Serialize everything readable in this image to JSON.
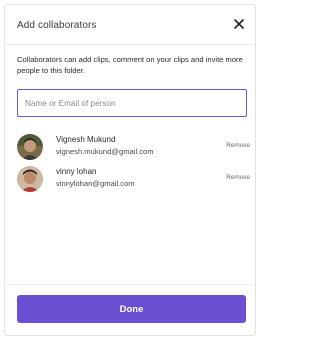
{
  "dialog": {
    "title": "Add collaborators",
    "description": "Collaborators can add clips, comment on your clips and invite more people to this folder.",
    "input_placeholder": "Name or Email of person",
    "done_label": "Done"
  },
  "collaborators": [
    {
      "name": "Vignesh Mukund",
      "email": "vignesh.mukund@gmail.com",
      "remove_label": "Remove"
    },
    {
      "name": "vinny lohan",
      "email": "vinnylohan@gmail.com",
      "remove_label": "Remove"
    }
  ],
  "colors": {
    "accent": "#6a4fd0",
    "input_border": "#6b5bd1"
  },
  "icons": {
    "close": "close-icon"
  }
}
